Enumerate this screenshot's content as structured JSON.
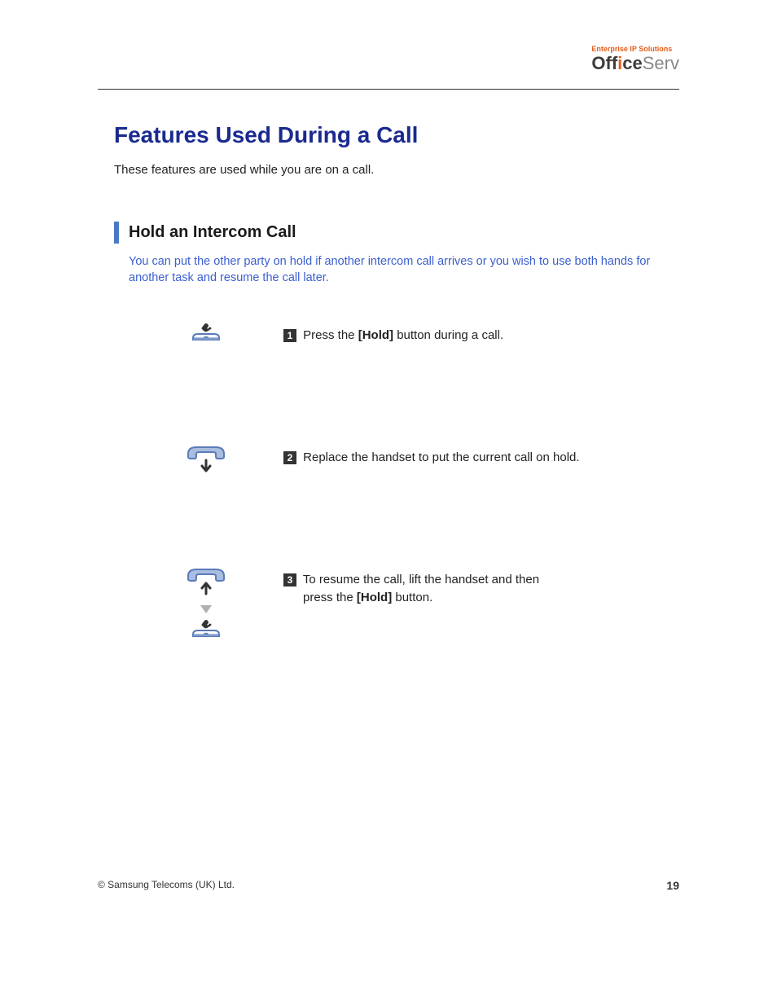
{
  "header": {
    "tagline": "Enterprise IP Solutions",
    "logo_office": "Off",
    "logo_i": "i",
    "logo_ce": "ce",
    "logo_serv": "Serv"
  },
  "main": {
    "heading": "Features Used During a Call",
    "intro": "These features are used while you are on a call.",
    "sub_heading": "Hold an Intercom Call",
    "sub_desc": "You can put the other party on hold if another intercom call arrives or you wish to use both hands for another task and resume the call later."
  },
  "steps": [
    {
      "num": "1",
      "line1_pre": " Press the ",
      "line1_bold": "[Hold]",
      "line1_post": " button during a call."
    },
    {
      "num": "2",
      "line1_pre": " Replace the handset to put the current call on hold.",
      "line1_bold": "",
      "line1_post": ""
    },
    {
      "num": "3",
      "line1_pre": " To resume the call, lift the handset and then",
      "line1_bold": "",
      "line1_post": "",
      "line2_pre": "press the ",
      "line2_bold": "[Hold]",
      "line2_post": " button."
    }
  ],
  "footer": {
    "copyright": "© Samsung Telecoms (UK) Ltd.",
    "page": "19"
  }
}
